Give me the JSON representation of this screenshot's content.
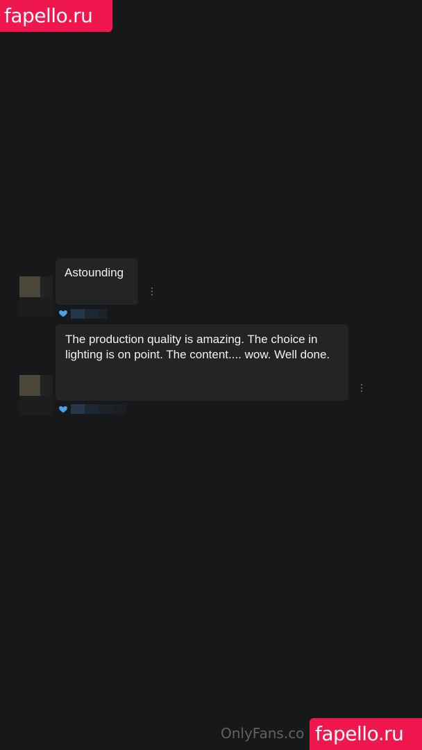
{
  "watermark": {
    "top_text": "fapello.ru",
    "bottom_text": "fapello.ru"
  },
  "footer": {
    "url_text": "OnlyFans.co"
  },
  "comments": [
    {
      "text": "Astounding"
    },
    {
      "text": "The production quality is amazing. The choice in lighting is on point. The content.... wow. Well done."
    }
  ],
  "icons": {
    "like": "heart-icon",
    "menu": "more-vertical-icon"
  },
  "colors": {
    "background": "#17181a",
    "bubble": "#222426",
    "heart": "#4aa3e8",
    "watermark": "#f0174f"
  }
}
